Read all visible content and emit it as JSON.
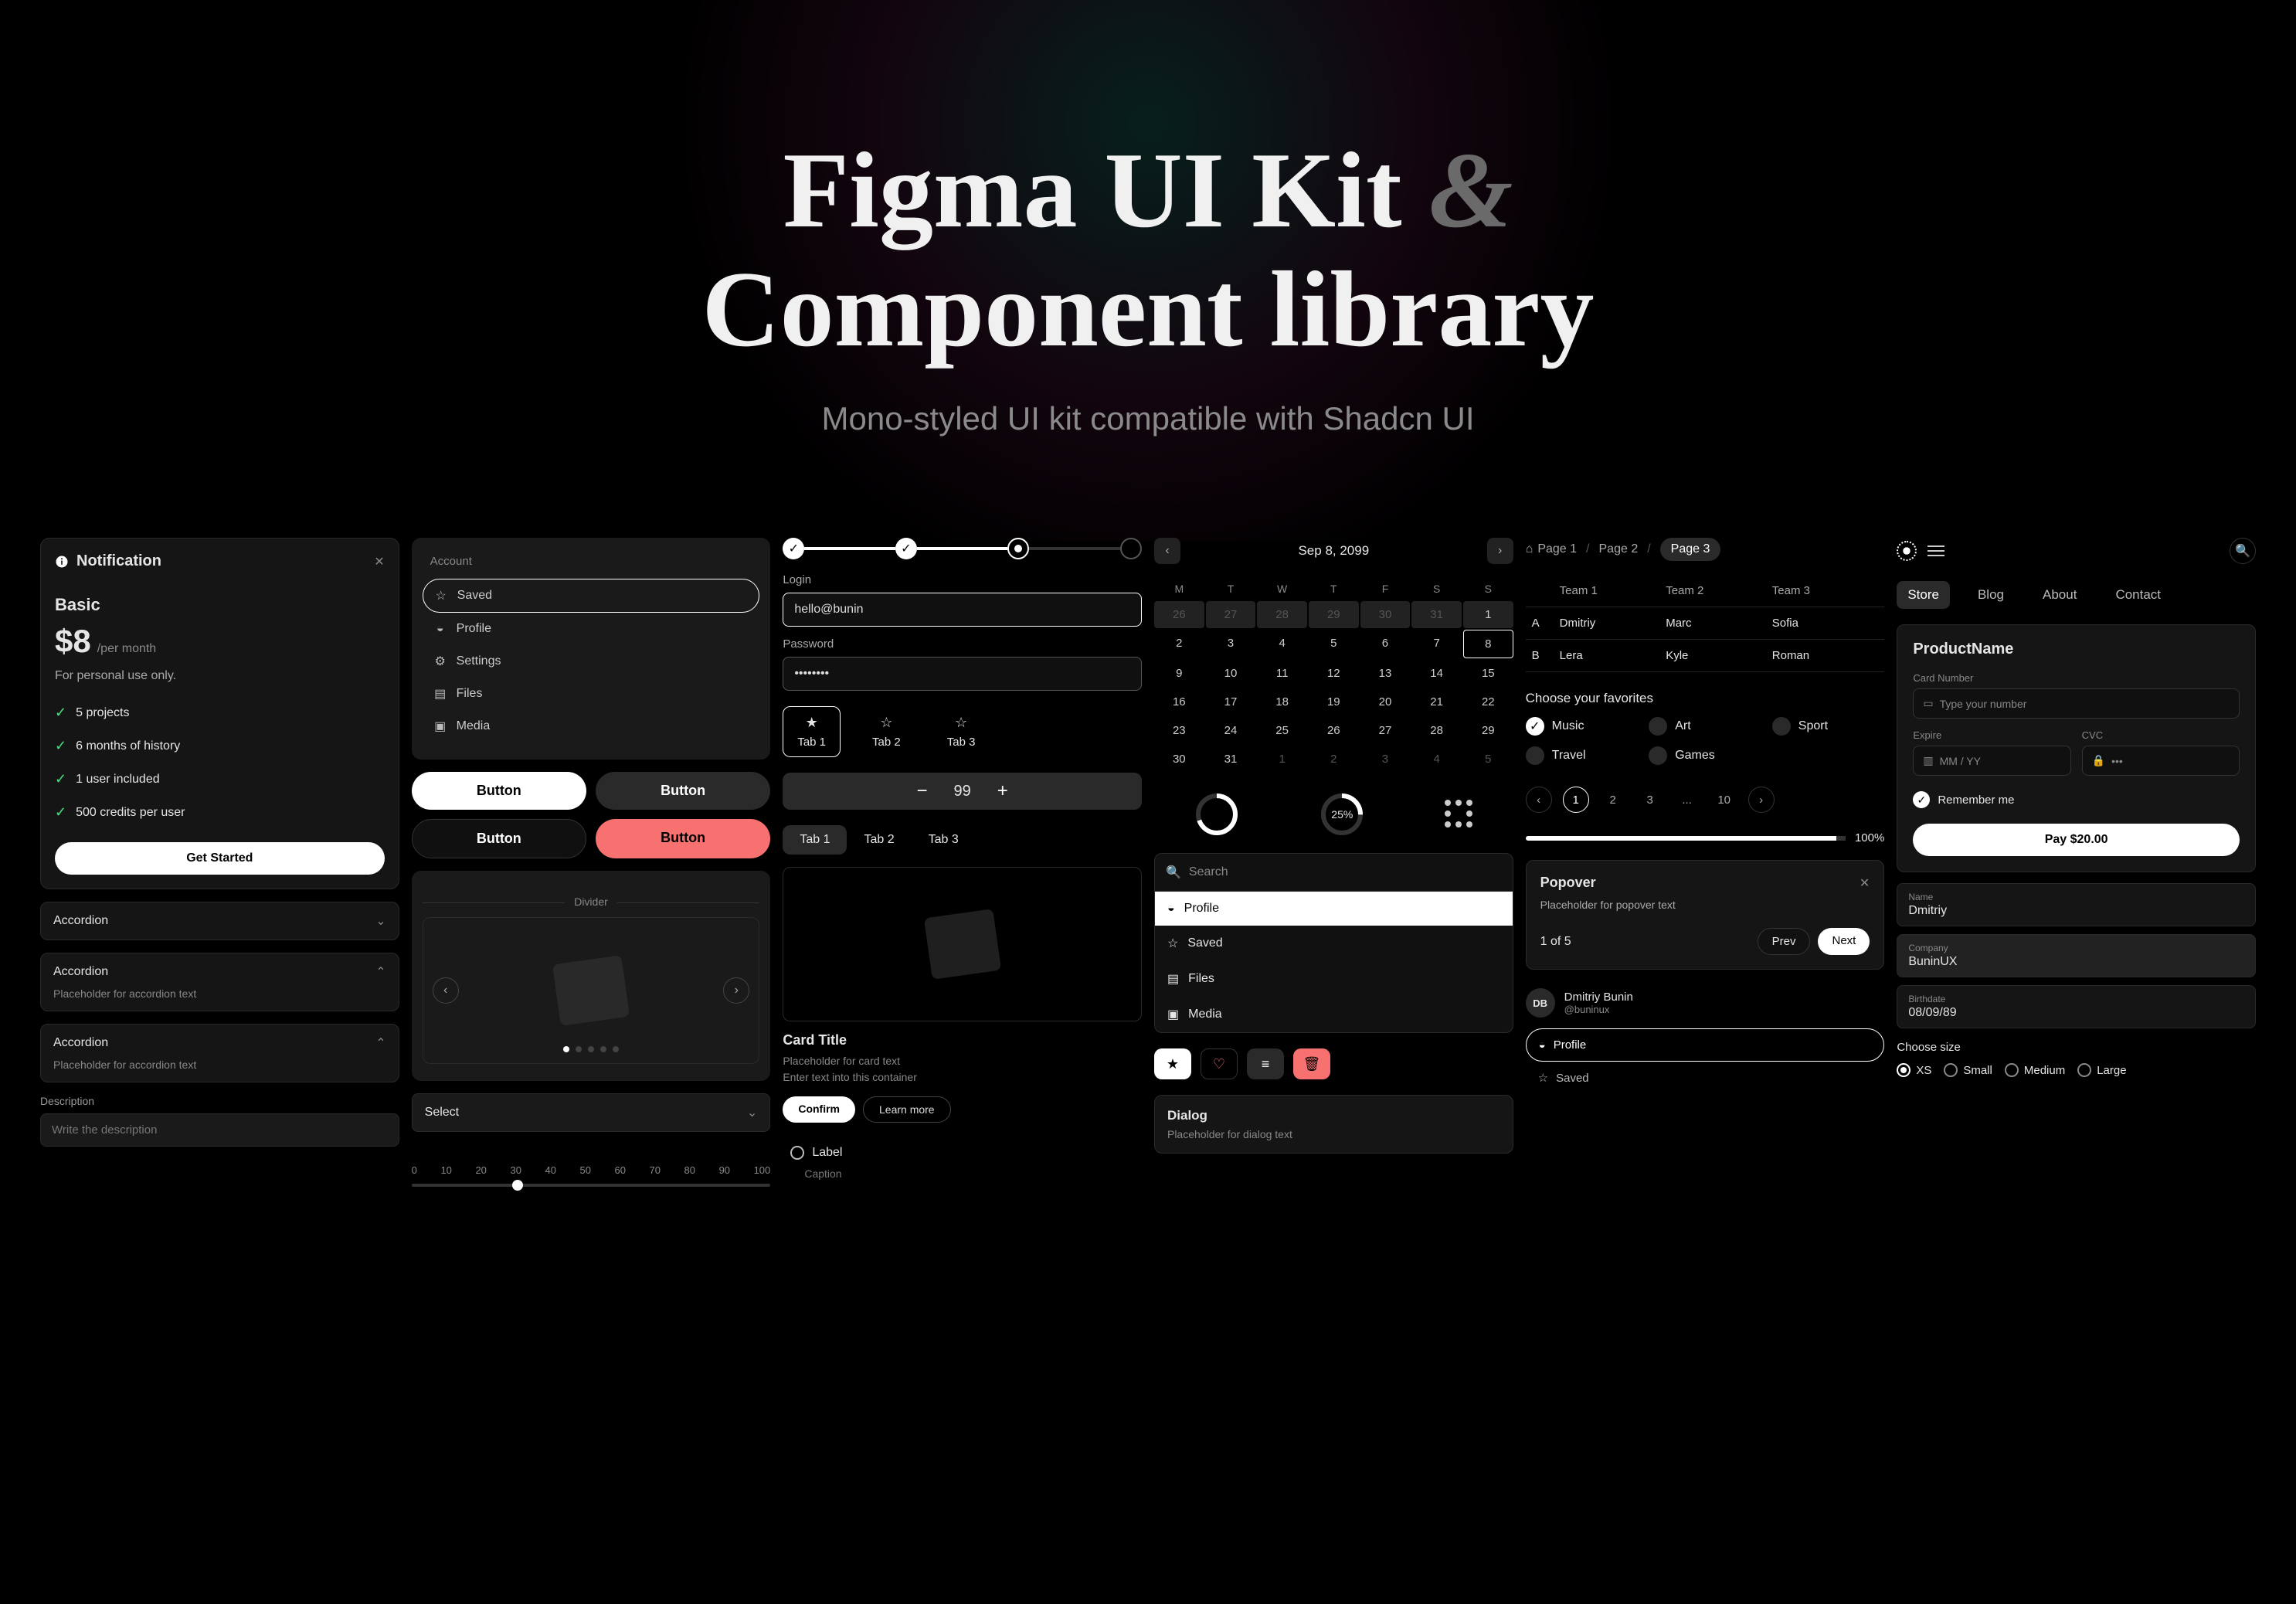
{
  "hero": {
    "title_a": "Figma UI Kit ",
    "title_amp": "&",
    "title_b": "Component library",
    "subtitle": "Mono-styled UI kit compatible with Shadcn UI"
  },
  "notification": {
    "heading": "Notification",
    "plan": "Basic",
    "price": "$8",
    "per": "/per month",
    "desc": "For personal use only.",
    "features": [
      "5 projects",
      "6 months of history",
      "1 user included",
      "500 credits per user"
    ],
    "cta": "Get Started"
  },
  "accordions": [
    {
      "title": "Accordion",
      "open": false
    },
    {
      "title": "Accordion",
      "open": true,
      "body": "Placeholder for accordion text"
    },
    {
      "title": "Accordion",
      "open": true,
      "body": "Placeholder for accordion text"
    }
  ],
  "description": {
    "label": "Description",
    "placeholder": "Write the description"
  },
  "account": {
    "label": "Account",
    "items": [
      {
        "icon": "star",
        "label": "Saved",
        "active": true
      },
      {
        "icon": "user",
        "label": "Profile"
      },
      {
        "icon": "gear",
        "label": "Settings"
      },
      {
        "icon": "file",
        "label": "Files"
      },
      {
        "icon": "image",
        "label": "Media"
      }
    ]
  },
  "buttons": [
    "Button",
    "Button",
    "Button",
    "Button"
  ],
  "divider": "Divider",
  "select": "Select",
  "ruler_ticks": [
    "0",
    "10",
    "20",
    "30",
    "40",
    "50",
    "60",
    "70",
    "80",
    "90",
    "100"
  ],
  "login": {
    "login_label": "Login",
    "login_value": "hello@bunin",
    "password_label": "Password",
    "password_value": "••••••••"
  },
  "tabs_star": [
    "Tab 1",
    "Tab 2",
    "Tab 3"
  ],
  "number_value": "99",
  "tabs_text": [
    "Tab 1",
    "Tab 2",
    "Tab 3"
  ],
  "cardel": {
    "title": "Card Title",
    "line1": "Placeholder for card text",
    "line2": "Enter text into this container",
    "confirm": "Confirm",
    "learn": "Learn more"
  },
  "radio": {
    "label": "Label",
    "caption": "Caption"
  },
  "calendar": {
    "title": "Sep 8, 2099",
    "dow": [
      "M",
      "T",
      "W",
      "T",
      "F",
      "S",
      "S"
    ],
    "rows": [
      [
        "26",
        "27",
        "28",
        "29",
        "30",
        "31",
        "1"
      ],
      [
        "2",
        "3",
        "4",
        "5",
        "6",
        "7",
        "8"
      ],
      [
        "9",
        "10",
        "11",
        "12",
        "13",
        "14",
        "15"
      ],
      [
        "16",
        "17",
        "18",
        "19",
        "20",
        "21",
        "22"
      ],
      [
        "23",
        "24",
        "25",
        "26",
        "27",
        "28",
        "29"
      ],
      [
        "30",
        "31",
        "1",
        "2",
        "3",
        "4",
        "5"
      ]
    ],
    "other_first": 6,
    "other_last_start": 2,
    "selected": "8"
  },
  "progress_pct": "25%",
  "search": {
    "placeholder": "Search",
    "items": [
      {
        "icon": "user",
        "label": "Profile",
        "active": true
      },
      {
        "icon": "star",
        "label": "Saved"
      },
      {
        "icon": "file",
        "label": "Files"
      },
      {
        "icon": "image",
        "label": "Media"
      }
    ]
  },
  "dialog": {
    "title": "Dialog",
    "body": "Placeholder for dialog text"
  },
  "breadcrumbs": [
    "Page 1",
    "Page 2",
    "Page 3"
  ],
  "table": {
    "head": [
      "",
      "Team 1",
      "Team 2",
      "Team 3"
    ],
    "rows": [
      [
        "A",
        "Dmitriy",
        "Marc",
        "Sofia"
      ],
      [
        "B",
        "Lera",
        "Kyle",
        "Roman"
      ]
    ]
  },
  "favorites": {
    "title": "Choose your favorites",
    "items": [
      {
        "label": "Music",
        "on": true
      },
      {
        "label": "Art",
        "on": false
      },
      {
        "label": "Sport",
        "on": false
      },
      {
        "label": "Travel",
        "on": false
      },
      {
        "label": "Games",
        "on": false
      }
    ]
  },
  "pagination": {
    "pages": [
      "1",
      "2",
      "3",
      "...",
      "10"
    ],
    "active": "1"
  },
  "slider_val": "100%",
  "popover": {
    "title": "Popover",
    "body": "Placeholder for popover text",
    "count": "1 of 5",
    "prev": "Prev",
    "next": "Next"
  },
  "user": {
    "initials": "DB",
    "name": "Dmitriy Bunin",
    "handle": "@buninux",
    "menu": [
      {
        "icon": "user",
        "label": "Profile",
        "active": true
      },
      {
        "icon": "star",
        "label": "Saved"
      }
    ]
  },
  "nav_tabs": [
    "Store",
    "Blog",
    "About",
    "Contact"
  ],
  "payment": {
    "title": "ProductName",
    "card_label": "Card Number",
    "card_placeholder": "Type your number",
    "expire_label": "Expire",
    "expire_placeholder": "MM / YY",
    "cvc_label": "CVC",
    "cvc_placeholder": "•••",
    "remember": "Remember me",
    "pay": "Pay $20.00"
  },
  "info": {
    "name_label": "Name",
    "name_val": "Dmitriy",
    "company_label": "Company",
    "company_val": "BuninUX",
    "birth_label": "Birthdate",
    "birth_val": "08/09/89"
  },
  "sizes": {
    "title": "Choose size",
    "options": [
      "XS",
      "Small",
      "Medium",
      "Large"
    ],
    "selected": "XS"
  }
}
